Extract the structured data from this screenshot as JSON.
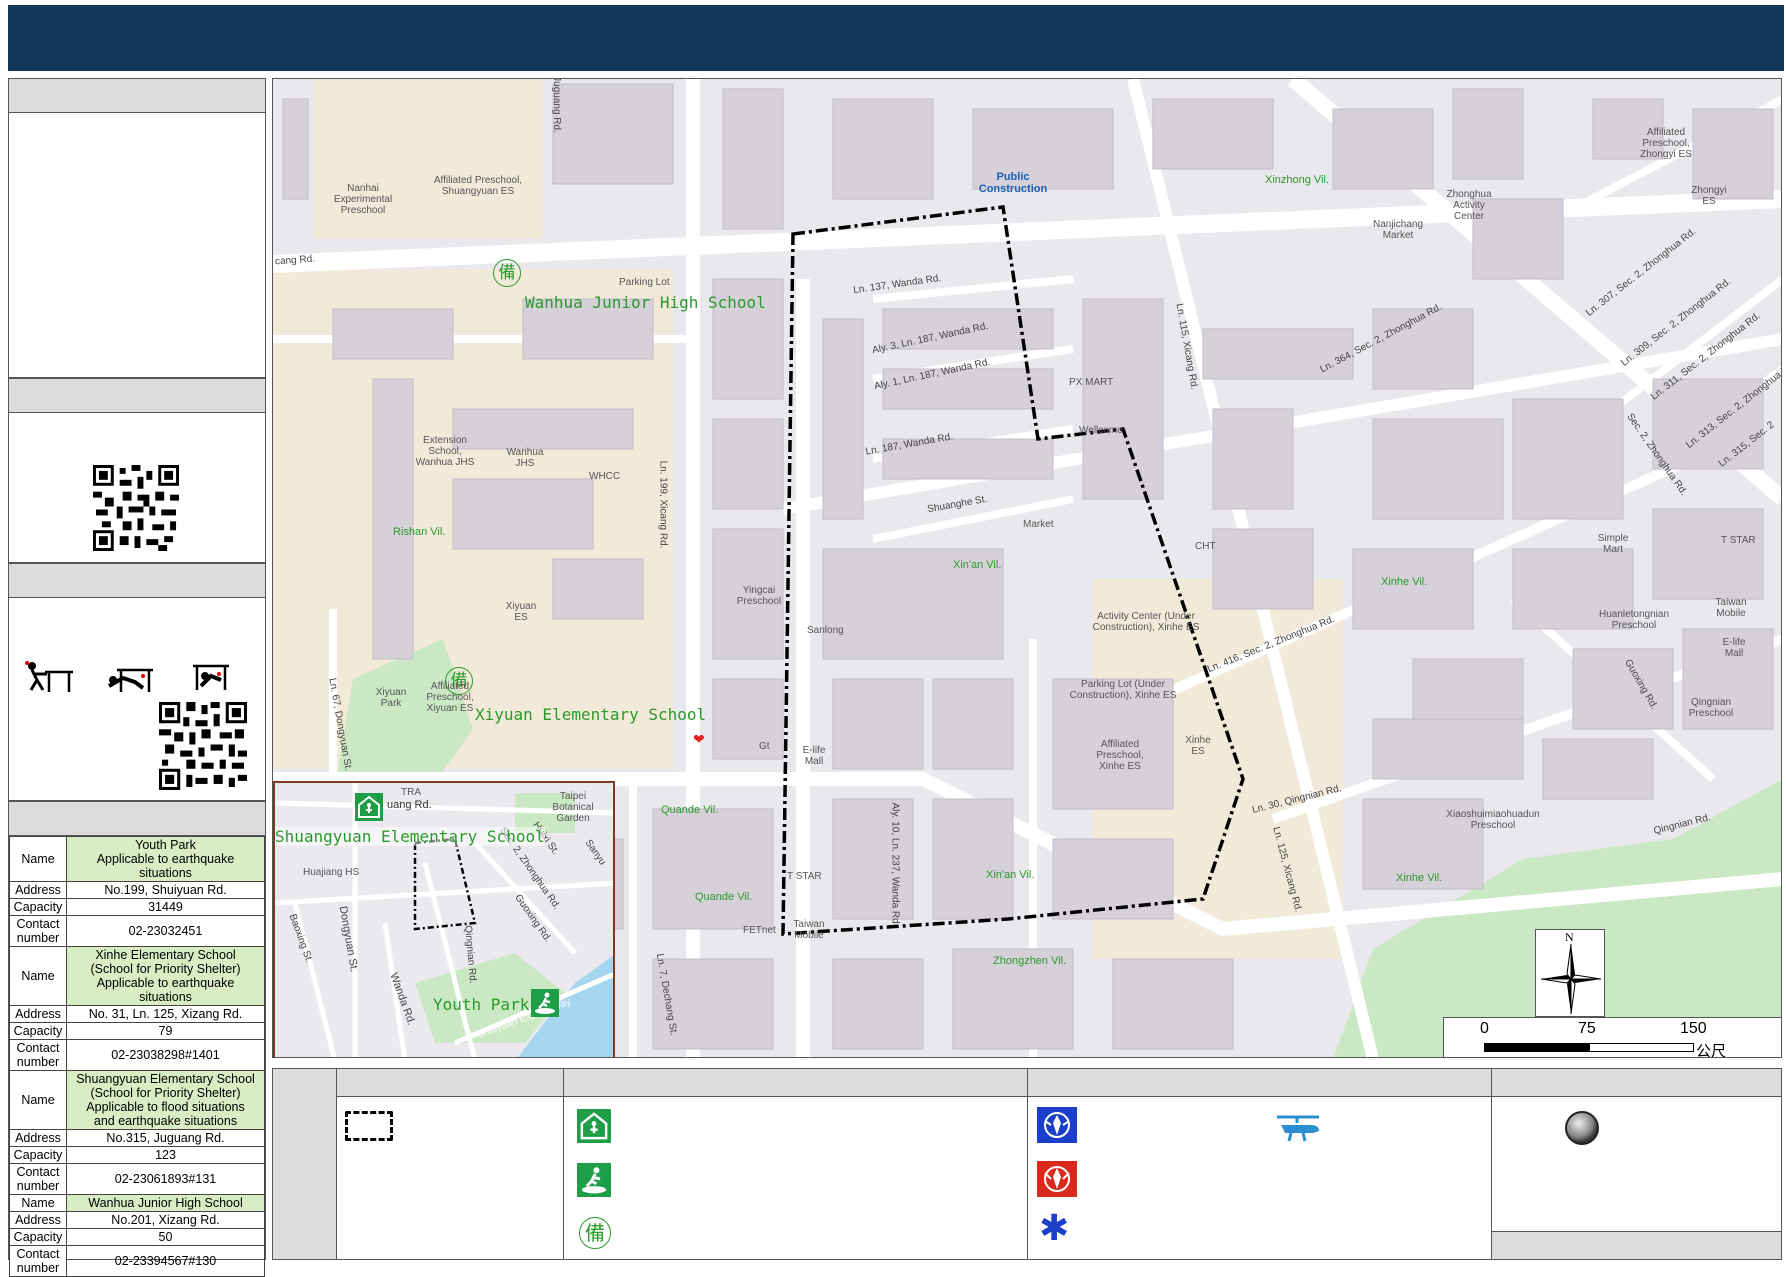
{
  "shelters": [
    {
      "name_lines": [
        "Youth Park",
        "Applicable to earthquake situations"
      ],
      "address": "No.199, Shuiyuan Rd.",
      "capacity": "31449",
      "contact": "02-23032451"
    },
    {
      "name_lines": [
        "Xinhe Elementary School",
        "(School for Priority Shelter)",
        "Applicable to earthquake situations"
      ],
      "address": "No. 31, Ln. 125, Xizang Rd.",
      "capacity": "79",
      "contact": "02-23038298#1401"
    },
    {
      "name_lines": [
        "Shuangyuan Elementary School",
        "(School for Priority Shelter)",
        "Applicable to flood situations",
        "and earthquake situations"
      ],
      "address": "No.315, Juguang Rd.",
      "capacity": "123",
      "contact": "02-23061893#131"
    },
    {
      "name_lines": [
        "Wanhua Junior High School"
      ],
      "address": "No.201, Xizang Rd.",
      "capacity": "50",
      "contact": "02-23394567#130"
    }
  ],
  "table_keys": {
    "name": "Name",
    "address": "Address",
    "capacity": "Capacity",
    "contact": "Contact number"
  },
  "map_labels": {
    "public_construction": "Public Construction",
    "wanhua_jhs": "Wanhua Junior High School",
    "xiyuan_es": "Xiyuan Elementary School",
    "shuangyuan_es": "Shuangyuan Elementary School",
    "youth_park": "Youth Park",
    "xinzhong_vil": "Xinzhong Vil.",
    "rishan_vil": "Rishan Vil.",
    "xinan_vil_1": "Xin'an Vil.",
    "xinan_vil_2": "Xin'an Vil.",
    "xinhe_vil_1": "Xinhe Vil.",
    "xinhe_vil_2": "Xinhe Vil.",
    "quande_vil_1": "Quande Vil.",
    "quande_vil_2": "Quande Vil.",
    "zhongzhen_vil": "Zhongzhen Vil.",
    "juguang_rd": "Juguang Rd.",
    "cang_rd": "cang Rd.",
    "ln137": "Ln. 137, Wanda Rd.",
    "aly3": "Aly. 3, Ln. 187, Wanda Rd.",
    "aly1": "Aly. 1, Ln. 187, Wanda Rd.",
    "ln187": "Ln. 187, Wanda Rd.",
    "shuanghe_st": "Shuanghe St.",
    "ln199": "Ln. 199, Xicang Rd.",
    "ln115": "Ln. 115, Xicang Rd.",
    "ln364": "Ln. 364, Sec. 2, Zhonghua Rd.",
    "ln416": "Ln. 416, Sec. 2, Zhonghua Rd.",
    "ln30": "Ln. 30, Qingnian Rd.",
    "ln125": "Ln. 125, Xicang Rd.",
    "aly10": "Aly. 10, Ln. 237, Wanda Rd.",
    "ln7": "Ln. 7, Dechang St.",
    "ln67": "Ln. 67, Dongyuan St.",
    "qingnian_rd": "Qingnian Rd.",
    "guoxing_rd": "Guoxing Rd.",
    "sec2_zh": "Sec. 2, Zhonghua Rd.",
    "ln307": "Ln. 307, Sec. 2, Zhonghua Rd.",
    "ln309": "Ln. 309, Sec. 2, Zhonghua Rd.",
    "ln311": "Ln. 311, Sec. 2, Zhonghua Rd.",
    "ln313": "Ln. 313, Sec. 2, Zhonghua Rd.",
    "ln315": "Ln. 315, Sec. 2",
    "nanhai": "Nanhai Experimental Preschool",
    "affil_shuang": "Affiliated Preschool, Shuangyuan ES",
    "parking_wanhua": "Parking Lot",
    "extension": "Extension School, Wanhua JHS",
    "wanhua_jhs_small": "Wanhua JHS",
    "whcc": "WHCC",
    "xiyuan_es_small": "Xiyuan ES",
    "xiyuan_park": "Xiyuan Park",
    "affil_xiyuan": "Affiliated Preschool, Xiyuan ES",
    "yingcai": "Yingcai Preschool",
    "sanlong": "Sanlong",
    "elife_mall": "E-life Mall",
    "tstar_1": "T STAR",
    "taiwan_mobile_1": "Taiwan Mobile",
    "fetnet": "FETnet",
    "px_mart": "PX MART",
    "wellcome": "Wellcome",
    "market": "Market",
    "cht": "CHT",
    "activity_center": "Activity Center (Under Construction), Xinhe ES",
    "parking_xinhe": "Parking Lot (Under Construction), Xinhe ES",
    "affil_xinhe": "Affiliated Preschool, Xinhe ES",
    "xinhe_es": "Xinhe ES",
    "nanjichang": "Nanjichang Market",
    "zhonghua_ac": "Zhonghua Activity Center",
    "affil_zhongyi": "Affiliated Preschool, Zhongyi ES",
    "zhongyi_es": "Zhongyi ES",
    "simple_mart": "Simple Mart",
    "tstar_2": "T STAR",
    "taiwan_mobile_2": "Taiwan Mobile",
    "elife_mall_2": "E-life Mall",
    "huanle": "Huanletongnian Preschool",
    "qingnian_pre": "Qingnian Preschool",
    "xiaoshuimiao": "Xiaoshuimiaohuadun Preschool",
    "gt": "Gt"
  },
  "inset_labels": {
    "tra": "TRA",
    "juguang": "uang Rd.",
    "taipei_garden": "Taipei Botanical Garden",
    "huajiang": "Huajiang HS",
    "baoxing": "Baoxing St.",
    "dongyuan": "Dongyuan St.",
    "wanda": "Wanda Rd.",
    "qingnian": "Qingnian Rd.",
    "guoxing": "Guoxing Rd.",
    "zhonghua": "Sec. 2, Zhonghua Rd.",
    "huixi": "Huixi St.",
    "sanyu": "Sanyu",
    "shuiyuan": "Shuiyuan Expressway"
  },
  "glyphs": {
    "bei": "備",
    "north": "N",
    "heart": "❤",
    "star": "✱"
  },
  "scale": {
    "t0": "0",
    "t1": "75",
    "t2": "150",
    "unit": "公尺"
  },
  "icons": [
    "shelter-building-icon",
    "evacuation-person-icon",
    "bei-icon",
    "police-icon",
    "fire-dept-icon",
    "ambulance-icon",
    "helicopter-icon",
    "gray-circle-icon"
  ],
  "colors": {
    "header": "#14365a",
    "green_label": "#2a9a2a",
    "boundary": "#000000",
    "park": "#c9e8c3",
    "school": "#f2ead8"
  }
}
